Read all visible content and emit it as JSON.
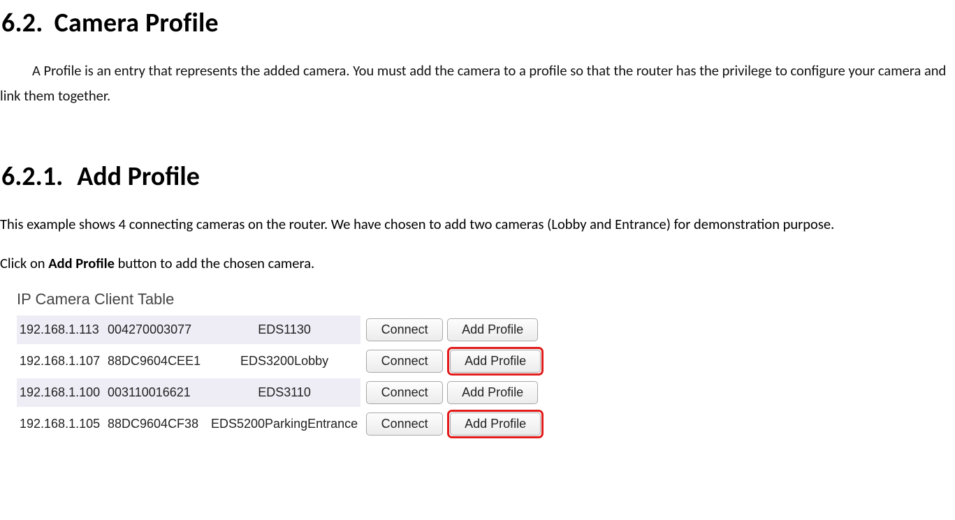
{
  "section": {
    "number": "6.2.",
    "title": "Camera Profile",
    "intro": "A Profile is an entry that represents the added camera. You must add the camera to a profile so that the router has the privilege to configure your camera and link them together."
  },
  "subsection": {
    "number": "6.2.1.",
    "title": "Add Profile",
    "desc": "This example shows 4 connecting cameras on the router. We have chosen to add two cameras (Lobby and Entrance) for demonstration purpose.",
    "instruction_prefix": "Click on ",
    "instruction_bold": "Add Profile",
    "instruction_suffix": " button to add the chosen camera."
  },
  "table": {
    "title": "IP Camera Client Table",
    "connect_label": "Connect",
    "add_label": "Add Profile",
    "rows": [
      {
        "ip": "192.168.1.113",
        "mac": "004270003077",
        "name": "EDS1130",
        "highlight": false
      },
      {
        "ip": "192.168.1.107",
        "mac": "88DC9604CEE1",
        "name": "EDS3200Lobby",
        "highlight": true
      },
      {
        "ip": "192.168.1.100",
        "mac": "003110016621",
        "name": "EDS3110",
        "highlight": false
      },
      {
        "ip": "192.168.1.105",
        "mac": "88DC9604CF38",
        "name": "EDS5200ParkingEntrance",
        "highlight": true
      }
    ]
  }
}
